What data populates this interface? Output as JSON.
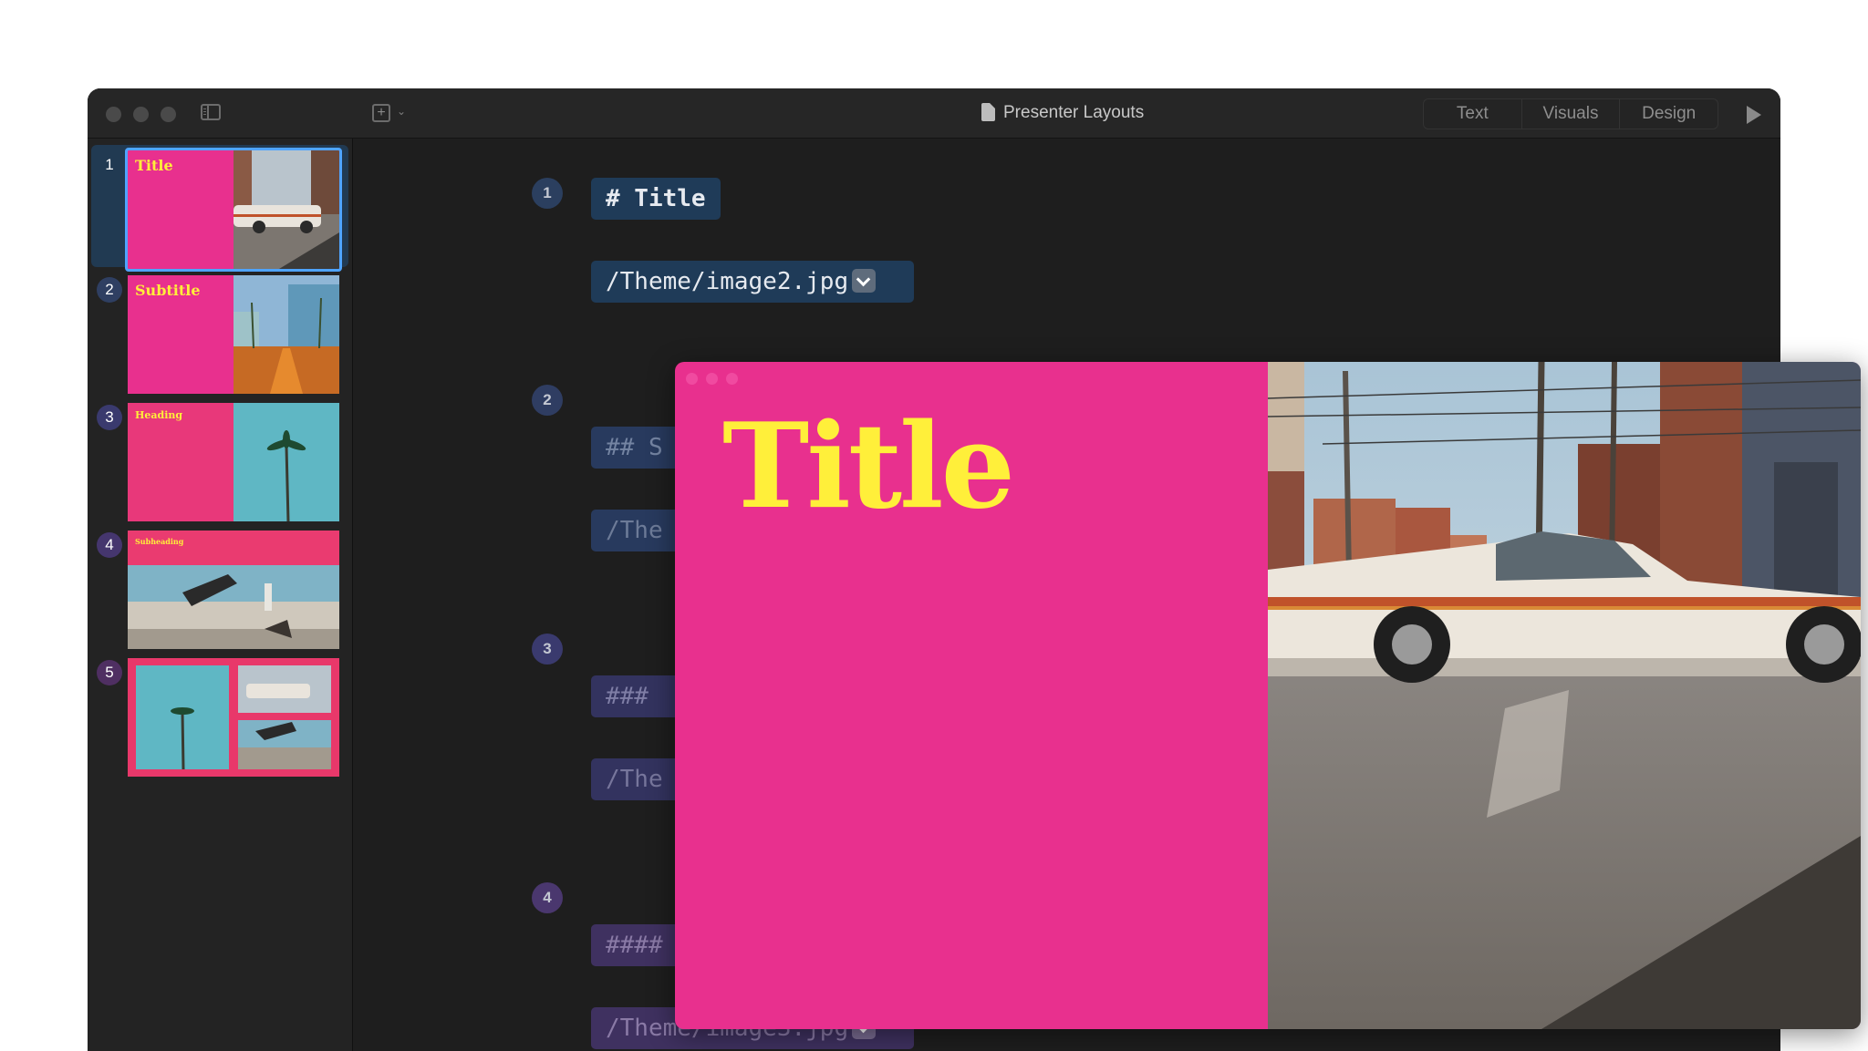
{
  "window": {
    "title": "Presenter Layouts",
    "segments": [
      "Text",
      "Visuals",
      "Design"
    ]
  },
  "sidebar": {
    "slides": [
      {
        "number": "1",
        "label": "Title"
      },
      {
        "number": "2",
        "label": "Subtitle"
      },
      {
        "number": "3",
        "label": "Heading"
      },
      {
        "number": "4",
        "label": "Subheading"
      },
      {
        "number": "5",
        "label": ""
      }
    ]
  },
  "editor": {
    "blocks": [
      {
        "number": "1",
        "heading": "# Title",
        "image": "/Theme/image2.jpg"
      },
      {
        "number": "2",
        "heading": "## S",
        "image": "/The"
      },
      {
        "number": "3",
        "heading": "###",
        "image": "/The"
      },
      {
        "number": "4",
        "heading": "####",
        "image": "/Theme/image3.jpg"
      }
    ],
    "separator": "---"
  },
  "preview": {
    "title": "Title"
  },
  "colors": {
    "pink": "#e8308e",
    "yellow": "#ffef3a",
    "selection": "#4fa4ff"
  }
}
